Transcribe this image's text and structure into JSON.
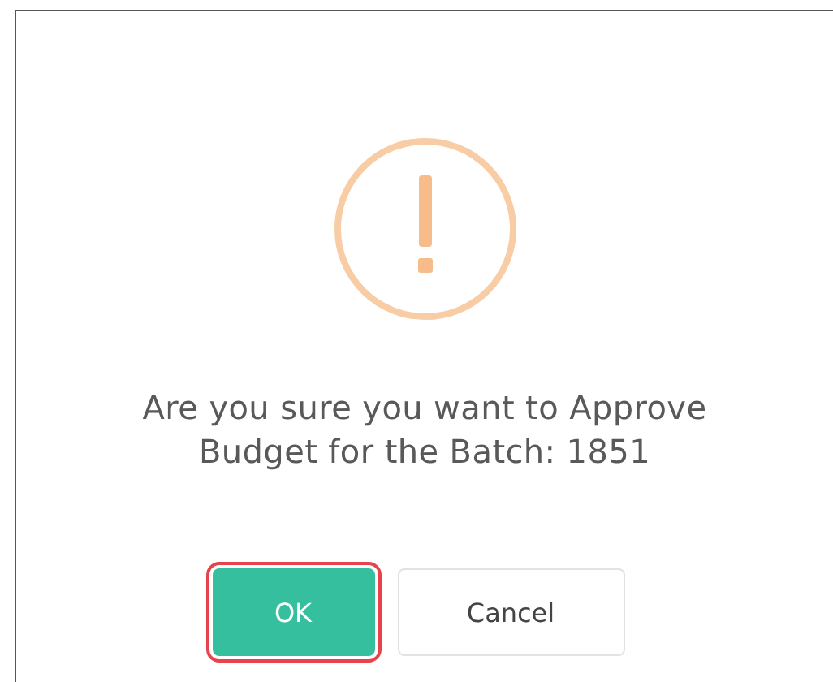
{
  "dialog": {
    "message": "Are you sure you want to Approve Budget for the Batch: 1851",
    "buttons": [
      {
        "label": "OK",
        "kind": "primary",
        "highlighted": true
      },
      {
        "label": "Cancel",
        "kind": "secondary",
        "highlighted": false
      }
    ]
  }
}
